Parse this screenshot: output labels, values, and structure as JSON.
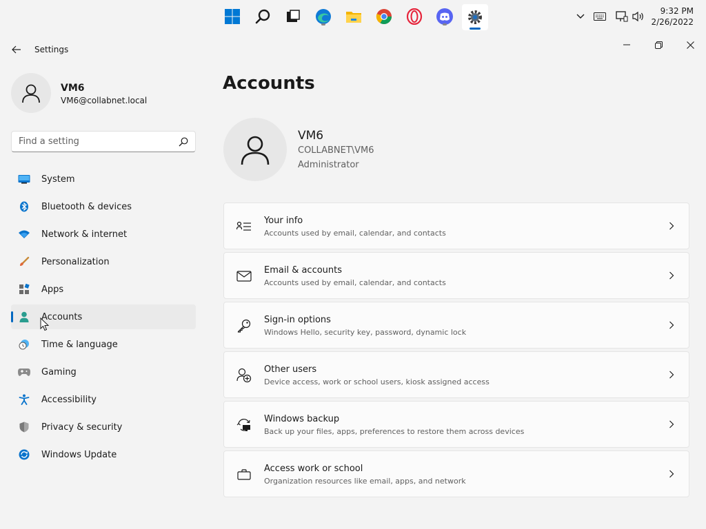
{
  "window": {
    "title": "Settings"
  },
  "taskbar": {
    "apps": [
      {
        "icon": "windows-start-icon",
        "active": false
      },
      {
        "icon": "search-icon",
        "active": false
      },
      {
        "icon": "task-view-icon",
        "active": false
      },
      {
        "icon": "edge-icon",
        "active": false
      },
      {
        "icon": "file-explorer-icon",
        "active": false
      },
      {
        "icon": "chrome-icon",
        "active": false
      },
      {
        "icon": "opera-icon",
        "active": false
      },
      {
        "icon": "discord-icon",
        "active": false
      },
      {
        "icon": "settings-gear-icon",
        "active": true
      }
    ],
    "time": "9:32 PM",
    "date": "2/26/2022"
  },
  "profile": {
    "name": "VM6",
    "email": "VM6@collabnet.local"
  },
  "search": {
    "placeholder": "Find a setting"
  },
  "sidebar": {
    "items": [
      {
        "label": "System",
        "icon": "system-display-icon",
        "selected": false
      },
      {
        "label": "Bluetooth & devices",
        "icon": "bluetooth-icon",
        "selected": false
      },
      {
        "label": "Network & internet",
        "icon": "wifi-icon",
        "selected": false
      },
      {
        "label": "Personalization",
        "icon": "brush-icon",
        "selected": false
      },
      {
        "label": "Apps",
        "icon": "apps-icon",
        "selected": false
      },
      {
        "label": "Accounts",
        "icon": "person-icon",
        "selected": true
      },
      {
        "label": "Time & language",
        "icon": "globe-clock-icon",
        "selected": false
      },
      {
        "label": "Gaming",
        "icon": "gamepad-icon",
        "selected": false
      },
      {
        "label": "Accessibility",
        "icon": "accessibility-icon",
        "selected": false
      },
      {
        "label": "Privacy & security",
        "icon": "shield-icon",
        "selected": false
      },
      {
        "label": "Windows Update",
        "icon": "update-icon",
        "selected": false
      }
    ]
  },
  "main": {
    "title": "Accounts",
    "account": {
      "name": "VM6",
      "domain": "COLLABNET\\VM6",
      "role": "Administrator"
    },
    "cards": [
      {
        "title": "Your info",
        "subtitle": "Accounts used by email, calendar, and contacts",
        "icon": "info-list-icon"
      },
      {
        "title": "Email & accounts",
        "subtitle": "Accounts used by email, calendar, and contacts",
        "icon": "mail-icon"
      },
      {
        "title": "Sign-in options",
        "subtitle": "Windows Hello, security key, password, dynamic lock",
        "icon": "key-icon"
      },
      {
        "title": "Other users",
        "subtitle": "Device access, work or school users, kiosk assigned access",
        "icon": "add-user-icon"
      },
      {
        "title": "Windows backup",
        "subtitle": "Back up your files, apps, preferences to restore them across devices",
        "icon": "backup-icon"
      },
      {
        "title": "Access work or school",
        "subtitle": "Organization resources like email, apps, and network",
        "icon": "briefcase-icon"
      }
    ]
  },
  "colors": {
    "accent": "#0067c0",
    "background": "#f3f3f3",
    "card": "#fbfbfb"
  }
}
